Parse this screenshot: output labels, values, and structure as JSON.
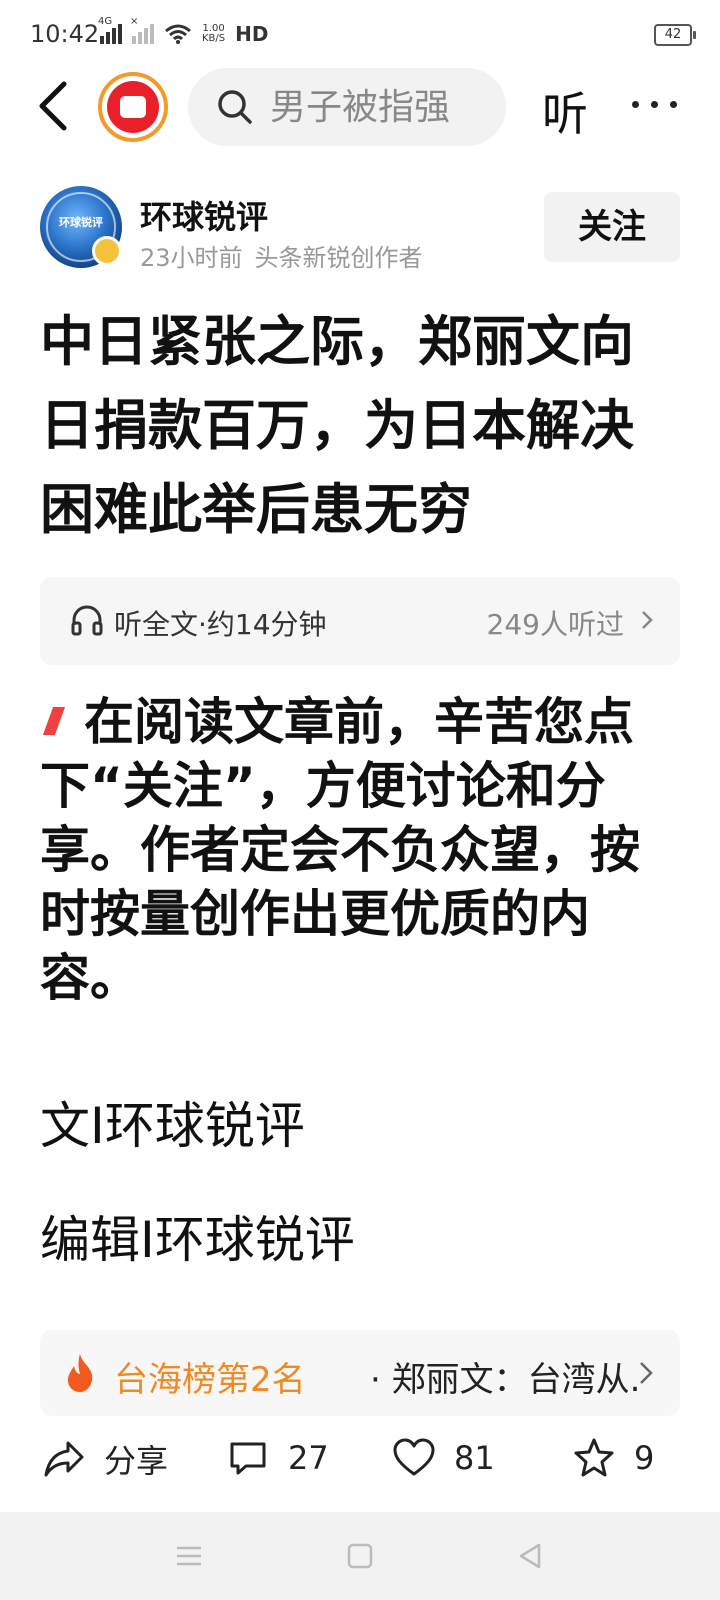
{
  "status_bar": {
    "time": "10:42",
    "network_a": "4G",
    "network_b": "×",
    "speed_value": "1.00",
    "speed_unit": "KB/S",
    "hd": "HD",
    "battery": "42"
  },
  "nav": {
    "search_placeholder": "男子被指强",
    "listen_label": "听"
  },
  "author": {
    "avatar_text": "环球锐评",
    "name": "环球锐评",
    "time": "23小时前",
    "role": "头条新锐创作者",
    "follow_label": "关注"
  },
  "article": {
    "title": "中日紧张之际，郑丽文向日捐款百万，为日本解决困难此举后患无穷",
    "listen_label": "听全文·约14分钟",
    "listen_count": "249人听过",
    "intro": "在阅读文章前，辛苦您点下“关注”，方便讨论和分享。作者定会不负众望，按时按量创作出更优质的内容。",
    "byline": "文I环球锐评",
    "editor": "编辑I环球锐评"
  },
  "hot": {
    "rank": "台海榜第2名",
    "text": "· 郑丽文：台湾从..."
  },
  "actions": {
    "share": "分享",
    "comments": "27",
    "likes": "81",
    "favorites": "9"
  },
  "colors": {
    "accent_red": "#f04142",
    "hot_orange": "#f08a24",
    "follow_bg": "#f2f2f2"
  }
}
